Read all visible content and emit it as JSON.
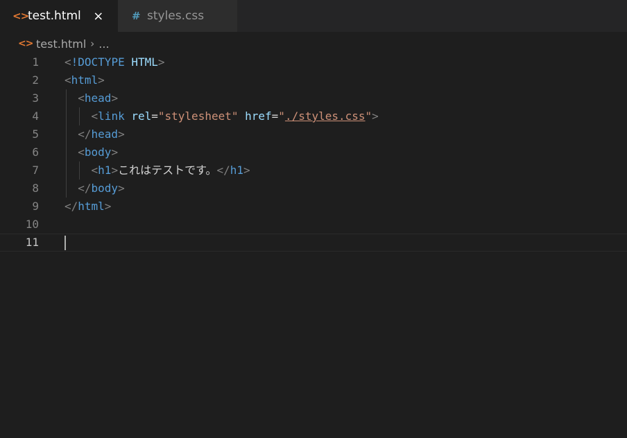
{
  "tabs": [
    {
      "icon": "<>",
      "label": "test.html",
      "close": "×",
      "active": true
    },
    {
      "icon": "#",
      "label": "styles.css",
      "active": false
    }
  ],
  "breadcrumb": {
    "icon": "<>",
    "file": "test.html",
    "separator": "›",
    "more": "..."
  },
  "editor": {
    "lines": [
      {
        "n": "1",
        "tokens": [
          [
            "punc",
            "<"
          ],
          [
            "tag",
            "!DOCTYPE"
          ],
          [
            "text",
            " "
          ],
          [
            "attr",
            "HTML"
          ],
          [
            "punc",
            ">"
          ]
        ]
      },
      {
        "n": "2",
        "tokens": [
          [
            "punc",
            "<"
          ],
          [
            "tag",
            "html"
          ],
          [
            "punc",
            ">"
          ]
        ]
      },
      {
        "n": "3",
        "tokens": [
          [
            "text",
            "  "
          ],
          [
            "punc",
            "<"
          ],
          [
            "tag",
            "head"
          ],
          [
            "punc",
            ">"
          ]
        ]
      },
      {
        "n": "4",
        "tokens": [
          [
            "text",
            "    "
          ],
          [
            "punc",
            "<"
          ],
          [
            "tag",
            "link"
          ],
          [
            "text",
            " "
          ],
          [
            "attr",
            "rel"
          ],
          [
            "text",
            "="
          ],
          [
            "str",
            "\"stylesheet\""
          ],
          [
            "text",
            " "
          ],
          [
            "attr",
            "href"
          ],
          [
            "text",
            "="
          ],
          [
            "str",
            "\""
          ],
          [
            "link",
            "./styles.css"
          ],
          [
            "str",
            "\""
          ],
          [
            "punc",
            ">"
          ]
        ]
      },
      {
        "n": "5",
        "tokens": [
          [
            "text",
            "  "
          ],
          [
            "punc",
            "</"
          ],
          [
            "tag",
            "head"
          ],
          [
            "punc",
            ">"
          ]
        ]
      },
      {
        "n": "6",
        "tokens": [
          [
            "text",
            "  "
          ],
          [
            "punc",
            "<"
          ],
          [
            "tag",
            "body"
          ],
          [
            "punc",
            ">"
          ]
        ]
      },
      {
        "n": "7",
        "tokens": [
          [
            "text",
            "    "
          ],
          [
            "punc",
            "<"
          ],
          [
            "tag",
            "h1"
          ],
          [
            "punc",
            ">"
          ],
          [
            "text",
            "これはテストです。"
          ],
          [
            "punc",
            "</"
          ],
          [
            "tag",
            "h1"
          ],
          [
            "punc",
            ">"
          ]
        ]
      },
      {
        "n": "8",
        "tokens": [
          [
            "text",
            "  "
          ],
          [
            "punc",
            "</"
          ],
          [
            "tag",
            "body"
          ],
          [
            "punc",
            ">"
          ]
        ]
      },
      {
        "n": "9",
        "tokens": [
          [
            "punc",
            "</"
          ],
          [
            "tag",
            "html"
          ],
          [
            "punc",
            ">"
          ]
        ]
      },
      {
        "n": "10",
        "tokens": []
      },
      {
        "n": "11",
        "tokens": [],
        "current": true
      }
    ]
  },
  "colors": {
    "background": "#1e1e1e",
    "tag": "#569cd6",
    "attribute": "#9cdcfe",
    "string": "#ce9178",
    "punctuation": "#808080",
    "html_icon": "#e37933",
    "css_icon": "#519aba"
  }
}
